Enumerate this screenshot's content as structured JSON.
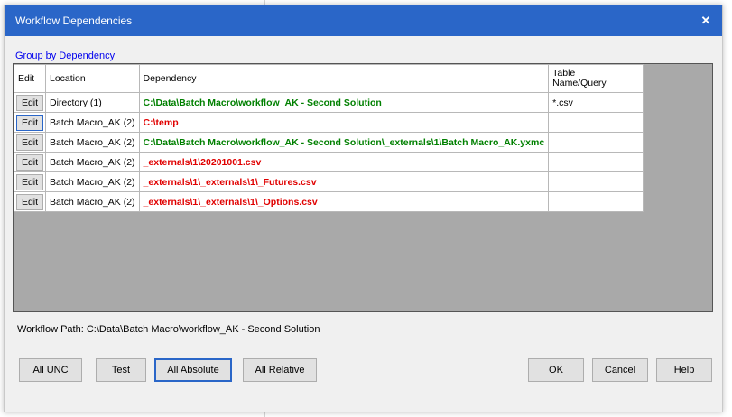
{
  "dialog": {
    "title": "Workflow Dependencies",
    "close_symbol": "✕",
    "group_link": "Group by Dependency",
    "workflow_path": "Workflow Path: C:\\Data\\Batch Macro\\workflow_AK - Second Solution"
  },
  "grid": {
    "headers": {
      "edit": "Edit",
      "location": "Location",
      "dependency": "Dependency",
      "table_line1": "Table",
      "table_line2": "Name/Query"
    },
    "rows": [
      {
        "edit": "Edit",
        "location": "Directory (1)",
        "dependency": "C:\\Data\\Batch Macro\\workflow_AK - Second Solution",
        "table": "*.csv",
        "status": "green"
      },
      {
        "edit": "Edit",
        "location": "Batch Macro_AK (2)",
        "dependency": "C:\\temp",
        "table": "",
        "status": "red"
      },
      {
        "edit": "Edit",
        "location": "Batch Macro_AK (2)",
        "dependency": "C:\\Data\\Batch Macro\\workflow_AK - Second Solution\\_externals\\1\\Batch Macro_AK.yxmc",
        "table": "",
        "status": "green"
      },
      {
        "edit": "Edit",
        "location": "Batch Macro_AK (2)",
        "dependency": "_externals\\1\\20201001.csv",
        "table": "",
        "status": "red"
      },
      {
        "edit": "Edit",
        "location": "Batch Macro_AK (2)",
        "dependency": "_externals\\1\\_externals\\1\\_Futures.csv",
        "table": "",
        "status": "red"
      },
      {
        "edit": "Edit",
        "location": "Batch Macro_AK (2)",
        "dependency": "_externals\\1\\_externals\\1\\_Options.csv",
        "table": "",
        "status": "red"
      }
    ]
  },
  "buttons": {
    "all_unc": "All UNC",
    "test": "Test",
    "all_absolute": "All Absolute",
    "all_relative": "All Relative",
    "ok": "OK",
    "cancel": "Cancel",
    "help": "Help"
  },
  "colors": {
    "titlebar": "#2a66c8",
    "valid_dependency": "#008000",
    "missing_dependency": "#e00000"
  }
}
